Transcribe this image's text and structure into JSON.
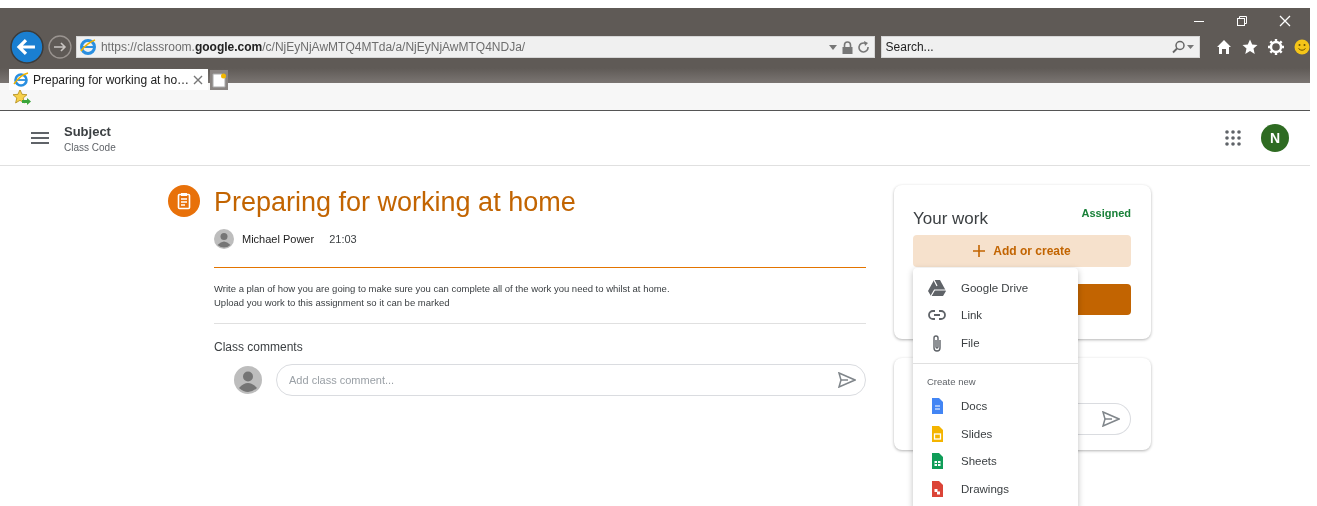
{
  "browser": {
    "address": {
      "url": "https://classroom.**google.com**/c/NjEyNjAwMTQ4MTda/a/NjEyNjAwMTQ4NDJa/"
    },
    "search": {
      "placeholder": "Search..."
    },
    "tabs": [
      {
        "title": "Preparing for working at ho…",
        "selected": true
      }
    ]
  },
  "app_bar": {
    "title": "Subject",
    "subtitle": "Class Code",
    "avatar": "N"
  },
  "assignment": {
    "title": "Preparing for working at home",
    "author": "Michael Power",
    "time": "21:03",
    "description": [
      "Write a plan of how you are going to make sure you can complete all of the work you need to whilst at home.",
      "Upload you work to this assignment so it can be marked"
    ],
    "comments_heading": "Class comments",
    "comment_field": {
      "placeholder": "Add class comment..."
    }
  },
  "your_work": {
    "title": "Your work",
    "status": "Assigned",
    "add_button": "Add or create"
  },
  "menu": {
    "items": [
      {
        "kind": "drive",
        "label": "Google Drive"
      },
      {
        "kind": "link",
        "label": "Link"
      },
      {
        "kind": "file",
        "label": "File"
      }
    ],
    "section": "Create new",
    "create_items": [
      {
        "kind": "docs",
        "label": "Docs"
      },
      {
        "kind": "slides",
        "label": "Slides"
      },
      {
        "kind": "sheets",
        "label": "Sheets"
      },
      {
        "kind": "drawings",
        "label": "Drawings"
      }
    ]
  }
}
